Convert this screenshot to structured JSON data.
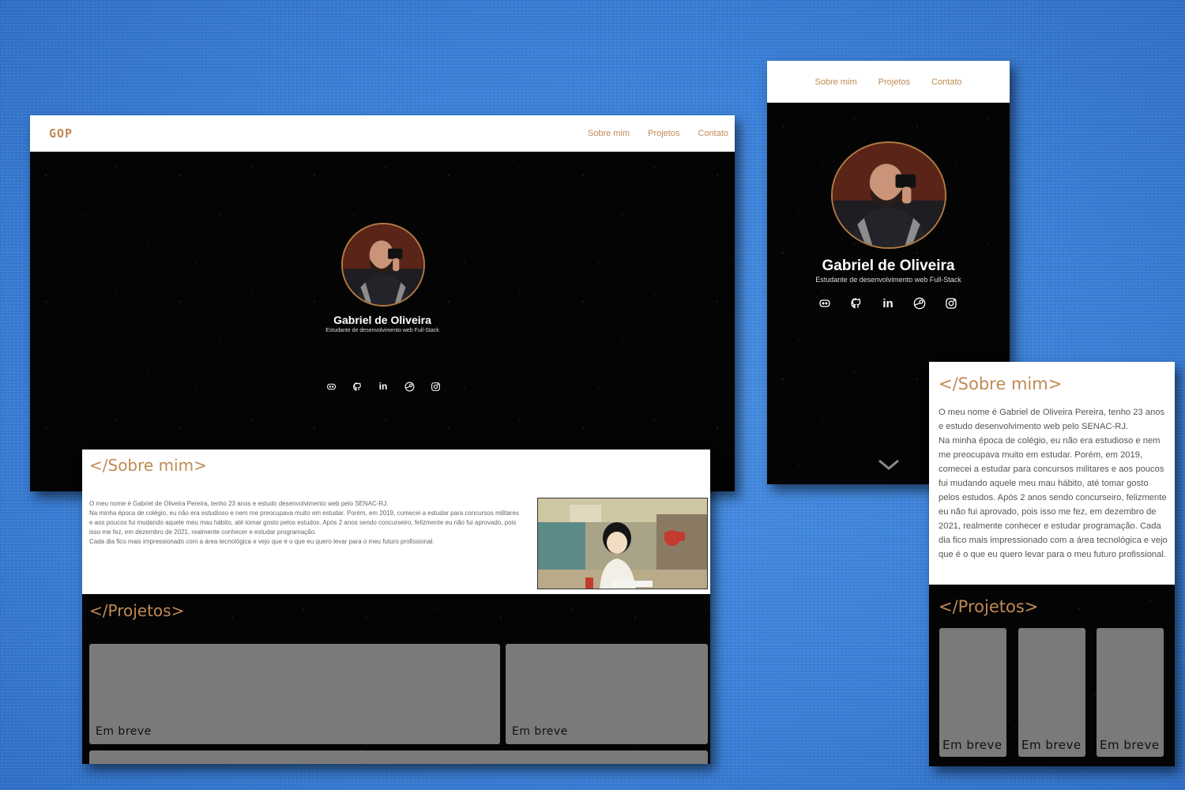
{
  "site": {
    "logo": "GOP",
    "nav": [
      "Sobre mim",
      "Projetos",
      "Contato"
    ]
  },
  "profile": {
    "name": "Gabriel de Oliveira",
    "subtitle": "Estudante de desenvolvimento web Full-Stack"
  },
  "socials": [
    "discord-icon",
    "github-icon",
    "linkedin-icon",
    "steam-icon",
    "instagram-icon"
  ],
  "about": {
    "title": "</Sobre mim>",
    "paragraphs": [
      "O meu nome é Gabriel de Oliveira Pereira, tenho 23 anos e estudo desenvolvimento web pelo SENAC-RJ.",
      "Na minha época de colégio, eu não era estudioso e nem me preocupava muito em estudar. Porém, em 2019, comecei a estudar para concursos militares e aos poucos fui mudando aquele meu mau hábito, até tomar gosto pelos estudos. Após 2 anos sendo concurseiro, felizmente eu não fui aprovado, pois isso me fez, em dezembro de 2021, realmente conhecer e estudar programação.",
      "Cada dia fico mais impressionado com a área tecnológica e vejo que é o que eu quero levar para o meu futuro profissional."
    ],
    "mobile_paragraphs": [
      "O meu nome é Gabriel de Oliveira Pereira, tenho 23 anos e estudo desenvolvimento web pelo SENAC-RJ.",
      "Na minha época de colégio, eu não era estudioso e nem me preocupava muito em estudar. Porém, em 2019, comecei a estudar para concursos militares e aos poucos fui mudando aquele meu mau hábito, até tomar gosto pelos estudos. Após 2 anos sendo concurseiro, felizmente eu não fui aprovado, pois isso me fez, em dezembro de 2021, realmente conhecer e estudar programação. Cada dia fico mais impressionado com a área tecnológica e vejo que é o que eu quero levar para o meu futuro profissional."
    ]
  },
  "projects": {
    "title": "</Projetos>",
    "cards": [
      "Em breve",
      "Em breve",
      "Em breve"
    ]
  },
  "colors": {
    "accent": "#c08a55",
    "background": "#3b83dc",
    "card": "#7a7a7a",
    "dark": "#040404"
  }
}
